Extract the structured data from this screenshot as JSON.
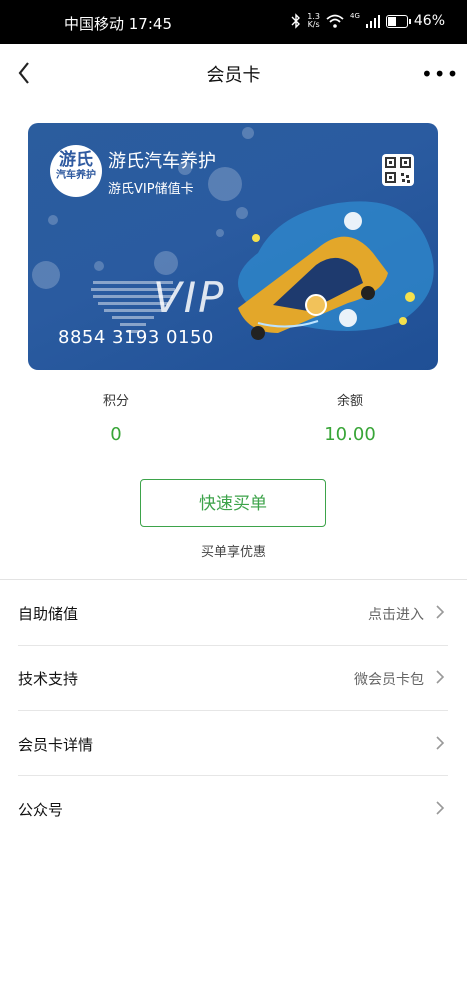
{
  "statusbar": {
    "carrier_time": "中国移动 17:45",
    "speed_top": "1.3",
    "speed_bottom": "K/s",
    "net": "4G",
    "battery": "46%",
    "battery_level": 0.46
  },
  "nav": {
    "title": "会员卡",
    "more": "•••"
  },
  "card": {
    "logo_big": "游氏",
    "logo_small": "汽车养护",
    "brand": "游氏汽车养护",
    "subtitle": "游氏VIP储值卡",
    "vip_text": "VIP",
    "number": "8854 3193 0150"
  },
  "stats": {
    "points_label": "积分",
    "points_value": "0",
    "balance_label": "余额",
    "balance_value": "10.00"
  },
  "quickbuy": {
    "label": "快速买单",
    "hint": "买单享优惠"
  },
  "menu": [
    {
      "label": "自助储值",
      "extra": "点击进入"
    },
    {
      "label": "技术支持",
      "extra": "微会员卡包"
    },
    {
      "label": "会员卡详情",
      "extra": ""
    },
    {
      "label": "公众号",
      "extra": ""
    }
  ]
}
